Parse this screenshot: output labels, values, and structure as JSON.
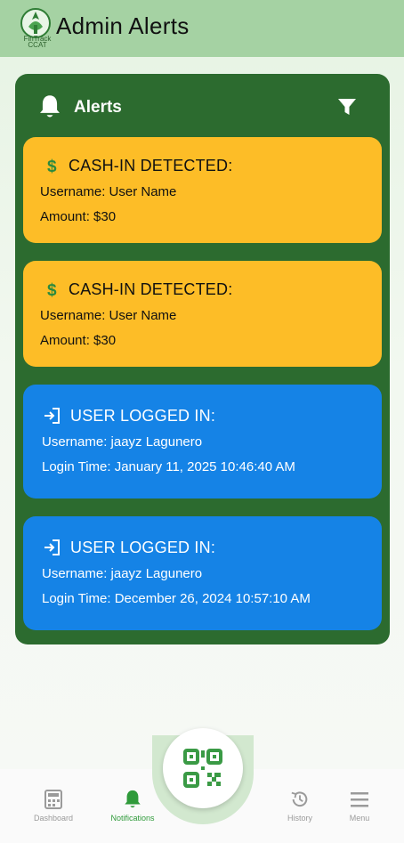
{
  "header": {
    "title": "Admin Alerts",
    "logo_text_line1": "FinTrack",
    "logo_text_line2": "CCAT"
  },
  "panel": {
    "title": "Alerts",
    "icons": {
      "bell": "bell-icon",
      "filter": "filter-icon"
    }
  },
  "alerts": [
    {
      "type": "cash",
      "title": "CASH-IN DETECTED:",
      "line1": "Username: User Name",
      "line2": "Amount: $30"
    },
    {
      "type": "cash",
      "title": "CASH-IN DETECTED:",
      "line1": "Username: User Name",
      "line2": "Amount: $30"
    },
    {
      "type": "login",
      "title": "USER LOGGED IN:",
      "line1": "Username: jaayz Lagunero",
      "line2": "Login Time: January 11, 2025 10:46:40 AM"
    },
    {
      "type": "login",
      "title": "USER LOGGED IN:",
      "line1": "Username: jaayz Lagunero",
      "line2": "Login Time: December 26, 2024 10:57:10 AM"
    }
  ],
  "nav": {
    "items": [
      {
        "label": "Dashboard",
        "icon": "calculator-icon",
        "active": false
      },
      {
        "label": "Notifications",
        "icon": "bell-icon",
        "active": true
      },
      {
        "label": "History",
        "icon": "history-icon",
        "active": false
      },
      {
        "label": "Menu",
        "icon": "menu-icon",
        "active": false
      }
    ],
    "center_icon": "qr-code-icon"
  },
  "colors": {
    "header": "#a5d2a3",
    "panel": "#2c6b2f",
    "cash_card": "#fdbd27",
    "login_card": "#1583e6",
    "accent": "#2f9a3a"
  }
}
